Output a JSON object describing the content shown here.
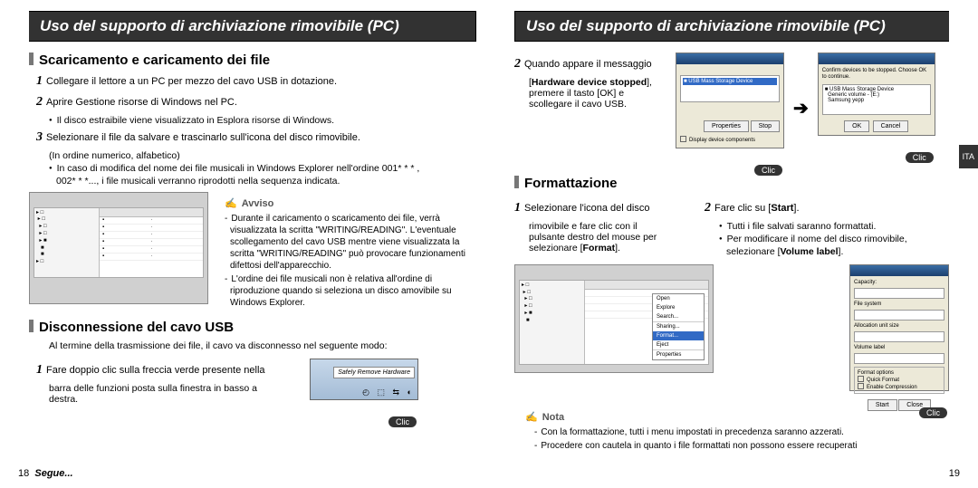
{
  "left": {
    "titlebar": "Uso del supporto di archiviazione rimovibile (PC)",
    "sec1": {
      "h": "Scaricamento e caricamento dei file",
      "s1": "Collegare il lettore a un PC per mezzo del cavo USB in dotazione.",
      "s2": "Aprire Gestione risorse di Windows nel PC.",
      "s2b": "Il disco estraibile viene visualizzato in Esplora risorse di Windows.",
      "s3": "Selezionare il file da salvare e trascinarlo sull'icona del disco rimovibile.",
      "s3a": "(In ordine numerico, alfabetico)",
      "s3b1": "In caso di modifica del nome dei file musicali in Windows Explorer nell'ordine 001* * * ,",
      "s3b2": "002* * *..., i file musicali verranno riprodotti nella sequenza indicata."
    },
    "avviso": {
      "h": "Avviso",
      "n1": "Durante il caricamento o scaricamento dei file, verrà visualizzata la scritta \"WRITING/READING\". L'eventuale scollegamento del cavo USB mentre viene visualizzata la scritta \"WRITING/READING\" può provocare funzionamenti difettosi dell'apparecchio.",
      "n2": "L'ordine dei file musicali non è relativa all'ordine di riproduzione quando si seleziona un disco amovibile su Windows Explorer."
    },
    "sec2": {
      "h": "Disconnessione del cavo USB",
      "intro": "Al termine della trasmissione dei file, il cavo va disconnesso nel seguente modo:",
      "s1a": "Fare doppio clic sulla freccia verde presente nella",
      "s1b": "barra delle funzioni posta sulla finestra in basso a",
      "s1c": "destra."
    },
    "clic": "Clic",
    "remove_label": "Safely Remove Hardware",
    "page": "18",
    "segue": "Segue..."
  },
  "right": {
    "titlebar": "Uso del supporto di archiviazione rimovibile (PC)",
    "s2top_a": "Quando appare il messaggio",
    "s2top_b": "[Hardware device stopped],",
    "s2top_c": "premere il tasto [OK] e",
    "s2top_d": "scollegare il cavo USB.",
    "clic": "Clic",
    "ita": "ITA",
    "sec3": {
      "h": "Formattazione",
      "s1a": "Selezionare l'icona del disco",
      "s1b": "rimovibile e fare clic con il",
      "s1c": "pulsante destro del mouse per",
      "s1d": "selezionare [Format].",
      "s2": "Fare clic su [Start].",
      "s2b1": "Tutti i file salvati saranno formattati.",
      "s2b2a": "Per modificare il nome del disco rimovibile,",
      "s2b2b": "selezionare [Volume label]."
    },
    "bold": {
      "hds": "Hardware device stopped",
      "ok": "OK",
      "format": "Format",
      "start": "Start",
      "vl": "Volume label"
    },
    "nota": {
      "h": "Nota",
      "n1": "Con la formattazione, tutti i menu impostati in precedenza saranno azzerati.",
      "n2": "Procedere con cautela in quanto i file formattati non possono essere recuperati"
    },
    "page": "19"
  }
}
